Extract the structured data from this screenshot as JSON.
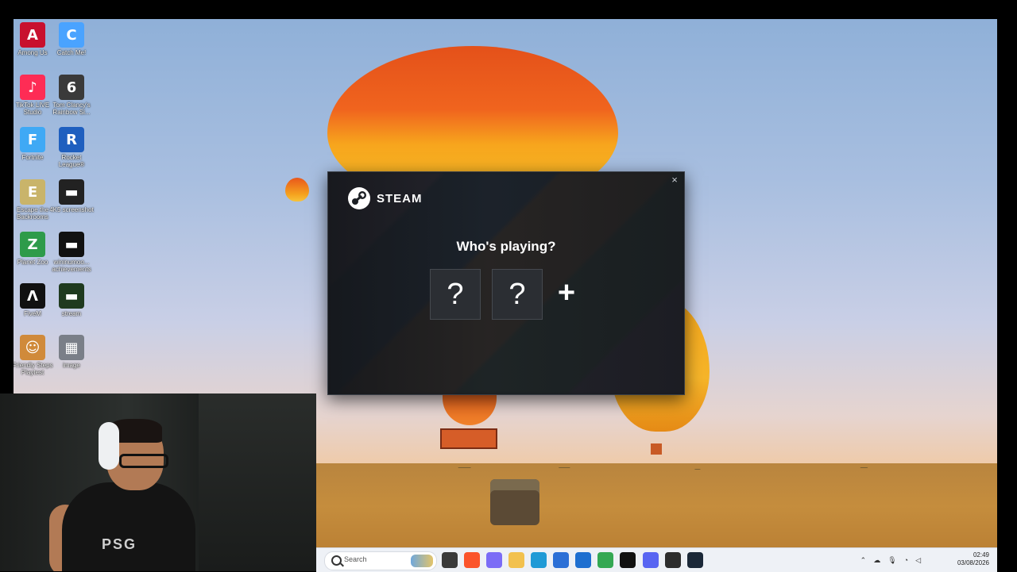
{
  "desktop": {
    "icons": [
      {
        "label": "Among Us",
        "icon": "among-us-icon",
        "color": "#c8102e",
        "glyph": "A"
      },
      {
        "label": "Catch Me!",
        "icon": "catch-me-icon",
        "color": "#4aa3ff",
        "glyph": "C"
      },
      {
        "label": "TikTok LIVE Studio",
        "icon": "tiktok-live-icon",
        "color": "#fe2c55",
        "glyph": "♪"
      },
      {
        "label": "Tom Clancy's Rainbow Si...",
        "icon": "rainbow-six-icon",
        "color": "#3a3a3a",
        "glyph": "6"
      },
      {
        "label": "Fortnite",
        "icon": "fortnite-icon",
        "color": "#3fa9f5",
        "glyph": "F"
      },
      {
        "label": "Rocket League®",
        "icon": "rocket-league-icon",
        "color": "#1f5fbf",
        "glyph": "R"
      },
      {
        "label": "Escape the Backrooms",
        "icon": "escape-backrooms-icon",
        "color": "#c9b46a",
        "glyph": "E"
      },
      {
        "label": "4K5 screenshot",
        "icon": "screenshot-file-icon",
        "color": "#222222",
        "glyph": "▬"
      },
      {
        "label": "Planet Zoo",
        "icon": "planet-zoo-icon",
        "color": "#2e9b4a",
        "glyph": "Z"
      },
      {
        "label": "wininumoo... achievements",
        "icon": "image-file-icon",
        "color": "#111111",
        "glyph": "▬"
      },
      {
        "label": "FiveM",
        "icon": "fivem-icon",
        "color": "#111111",
        "glyph": "Λ"
      },
      {
        "label": "stream",
        "icon": "stream-file-icon",
        "color": "#1f3a1f",
        "glyph": "▬"
      },
      {
        "label": "Friendly Steps Playtest",
        "icon": "friendly-steps-icon",
        "color": "#d08a3a",
        "glyph": "☺"
      },
      {
        "label": "image",
        "icon": "image-thumbnail-icon",
        "color": "#7a7f88",
        "glyph": "▦"
      }
    ]
  },
  "steam": {
    "brand": "STEAM",
    "heading": "Who's playing?",
    "close_label": "×",
    "accounts": [
      {
        "label": "?"
      },
      {
        "label": "?"
      }
    ],
    "add_label": "+"
  },
  "webcam": {
    "jersey_text": "PSG"
  },
  "taskbar": {
    "search_placeholder": "Search",
    "apps": [
      {
        "name": "task-view",
        "color": "#3a3a3a"
      },
      {
        "name": "brave",
        "color": "#fb542b"
      },
      {
        "name": "copilot",
        "color": "#7b6cf6"
      },
      {
        "name": "file-explorer",
        "color": "#f2c14e"
      },
      {
        "name": "edge",
        "color": "#1f9ad6"
      },
      {
        "name": "microsoft-store",
        "color": "#2b6fd6"
      },
      {
        "name": "outlook",
        "color": "#1e6fd0"
      },
      {
        "name": "chrome",
        "color": "#34a853"
      },
      {
        "name": "fivem",
        "color": "#111111"
      },
      {
        "name": "discord",
        "color": "#5865f2"
      },
      {
        "name": "obs",
        "color": "#2d2d2d"
      },
      {
        "name": "steam",
        "color": "#1b2838"
      }
    ],
    "time": "02:49",
    "date": "03/08/2026"
  }
}
